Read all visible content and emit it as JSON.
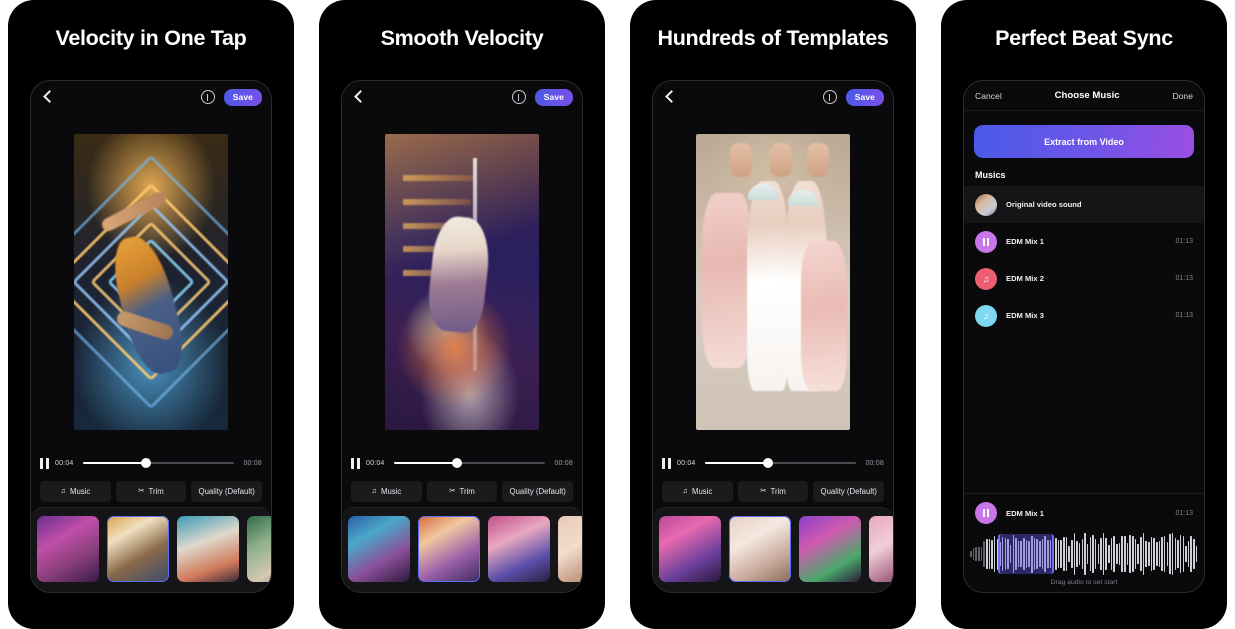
{
  "panels": [
    {
      "title": "Velocity in One Tap",
      "kind": "editor",
      "topbar": {
        "back_icon": "chevron-left-icon",
        "info_icon": "info-icon",
        "save_label": "Save"
      },
      "player": {
        "pause_icon": "pause-icon",
        "current_time": "00:04",
        "total_time": "00:08",
        "progress_pct": 42
      },
      "tools": [
        {
          "icon": "music-note-icon",
          "glyph": "♫",
          "label": "Music"
        },
        {
          "icon": "scissors-icon",
          "glyph": "✂",
          "label": "Trim"
        },
        {
          "icon": "none",
          "glyph": "",
          "label": "Quality (Default)"
        }
      ],
      "thumbnails": [
        {
          "name": "template-thumb-1",
          "selected": false
        },
        {
          "name": "template-thumb-2",
          "selected": true
        },
        {
          "name": "template-thumb-3",
          "selected": false
        },
        {
          "name": "template-thumb-4",
          "selected": false
        }
      ]
    },
    {
      "title": "Smooth Velocity",
      "kind": "editor",
      "topbar": {
        "back_icon": "chevron-left-icon",
        "info_icon": "info-icon",
        "save_label": "Save"
      },
      "player": {
        "pause_icon": "pause-icon",
        "current_time": "00:04",
        "total_time": "00:08",
        "progress_pct": 42
      },
      "tools": [
        {
          "icon": "music-note-icon",
          "glyph": "♫",
          "label": "Music"
        },
        {
          "icon": "scissors-icon",
          "glyph": "✂",
          "label": "Trim"
        },
        {
          "icon": "none",
          "glyph": "",
          "label": "Quality (Default)"
        }
      ],
      "thumbnails": [
        {
          "name": "template-thumb-1",
          "selected": false
        },
        {
          "name": "template-thumb-2",
          "selected": true
        },
        {
          "name": "template-thumb-3",
          "selected": false
        },
        {
          "name": "template-thumb-4",
          "selected": false
        }
      ]
    },
    {
      "title": "Hundreds of Templates",
      "kind": "editor",
      "topbar": {
        "back_icon": "chevron-left-icon",
        "info_icon": "info-icon",
        "save_label": "Save"
      },
      "player": {
        "pause_icon": "pause-icon",
        "current_time": "00:04",
        "total_time": "00:08",
        "progress_pct": 42
      },
      "tools": [
        {
          "icon": "music-note-icon",
          "glyph": "♫",
          "label": "Music"
        },
        {
          "icon": "scissors-icon",
          "glyph": "✂",
          "label": "Trim"
        },
        {
          "icon": "none",
          "glyph": "",
          "label": "Quality (Default)"
        }
      ],
      "thumbnails": [
        {
          "name": "template-thumb-1",
          "selected": false
        },
        {
          "name": "template-thumb-2",
          "selected": true
        },
        {
          "name": "template-thumb-3",
          "selected": false
        },
        {
          "name": "template-thumb-4",
          "selected": false
        }
      ]
    },
    {
      "title": "Perfect Beat Sync",
      "kind": "music",
      "music": {
        "cancel_label": "Cancel",
        "screen_title": "Choose Music",
        "done_label": "Done",
        "extract_label": "Extract from Video",
        "section_label": "Musics",
        "rows": [
          {
            "title": "Original video sound",
            "duration": "",
            "avatar": "photo-thumb-avatar",
            "avatar_color": "",
            "icon": ""
          },
          {
            "title": "EDM Mix 1",
            "duration": "01:13",
            "avatar": "pause-avatar",
            "avatar_color": "#c977e8",
            "icon": "pause-icon"
          },
          {
            "title": "EDM Mix 2",
            "duration": "01:13",
            "avatar": "music-note-avatar",
            "avatar_color": "#ec5f72",
            "icon": "music-note-icon"
          },
          {
            "title": "EDM Mix 3",
            "duration": "01:13",
            "avatar": "music-note-avatar",
            "avatar_color": "#7fd8f2",
            "icon": "music-note-icon"
          }
        ],
        "selected": {
          "title": "EDM Mix 1",
          "duration": "01:13",
          "avatar_color": "#c977e8",
          "icon": "pause-icon"
        },
        "waveform_hint": "Drag audio to set start",
        "waveform_selection": {
          "start_pct": 13,
          "width_pct": 24
        }
      }
    }
  ],
  "theme": {
    "card_bg": "#000000",
    "page_bg": "#ffffff",
    "accent_blue": "#4a5ae8",
    "accent_purple": "#9b4fe0",
    "selected_outline": "#5b6ff0"
  }
}
